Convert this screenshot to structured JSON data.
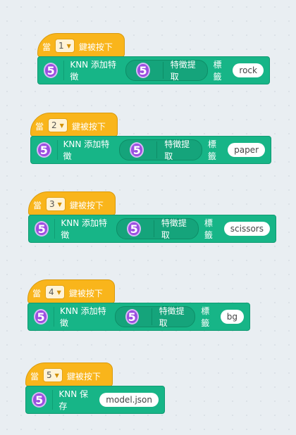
{
  "stacks": [
    {
      "when_label": "當",
      "key": "1",
      "pressed_label": "鍵被按下",
      "action": "KNN 添加特徵",
      "reporter": "特徵提取",
      "label_text": "標籤",
      "value": "rock"
    },
    {
      "when_label": "當",
      "key": "2",
      "pressed_label": "鍵被按下",
      "action": "KNN 添加特徵",
      "reporter": "特徵提取",
      "label_text": "標籤",
      "value": "paper"
    },
    {
      "when_label": "當",
      "key": "3",
      "pressed_label": "鍵被按下",
      "action": "KNN 添加特徵",
      "reporter": "特徵提取",
      "label_text": "標籤",
      "value": "scissors"
    },
    {
      "when_label": "當",
      "key": "4",
      "pressed_label": "鍵被按下",
      "action": "KNN 添加特徵",
      "reporter": "特徵提取",
      "label_text": "標籤",
      "value": "bg"
    },
    {
      "when_label": "當",
      "key": "5",
      "pressed_label": "鍵被按下",
      "action": "KNN 保存",
      "value": "model.json"
    }
  ],
  "extension_icon_text": "5",
  "colors": {
    "event": "#f9b51b",
    "extension": "#17b587",
    "icon": "#9b4fe0"
  }
}
